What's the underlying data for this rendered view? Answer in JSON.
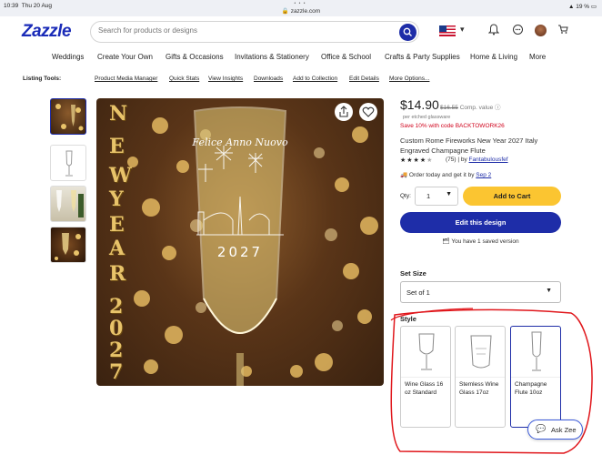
{
  "statusbar": {
    "time": "10:39",
    "date": "Thu 20 Aug",
    "url": "zazzle.com",
    "battery": "19 %"
  },
  "header": {
    "logo": "Zazzle",
    "search_placeholder": "Search for products or designs"
  },
  "nav": [
    "Weddings",
    "Create Your Own",
    "Gifts & Occasions",
    "Invitations & Stationery",
    "Office & School",
    "Crafts & Party Supplies",
    "Home & Living",
    "More"
  ],
  "listing_tools": {
    "label": "Listing Tools:",
    "links": [
      "Product Media Manager",
      "Quick Stats",
      "View Insights",
      "Downloads",
      "Add to Collection",
      "Edit Details",
      "More Options..."
    ]
  },
  "hero": {
    "ny_text": [
      "N",
      "E",
      "W",
      "Y",
      "E",
      "A",
      "R",
      "2",
      "0",
      "2",
      "7"
    ],
    "glass_text": "Felice Anno Nuovo",
    "glass_year": "2027"
  },
  "product": {
    "price": "$14.90",
    "old_price": "$16.55",
    "comp": "Comp. value",
    "per_unit": "per etched glassware",
    "promo": "Save 10% with code BACKTOWORK26",
    "title": "Custom Rome Fireworks New Year 2027 Italy Engraved Champagne Flute",
    "rating_stars": 4.5,
    "rating_count": "(75)",
    "by": "| by",
    "seller": "Fantabulousfef",
    "delivery_text": "Order today and get it by",
    "delivery_date": "Sep 2",
    "qty_label": "Qty:",
    "qty_value": "1",
    "add_to_cart": "Add to Cart",
    "edit_design": "Edit this design",
    "saved_version": "You have 1 saved version"
  },
  "set_size": {
    "label": "Set Size",
    "value": "Set of 1"
  },
  "style": {
    "label": "Style",
    "options": [
      {
        "label": "Wine Glass 16 oz Standard",
        "selected": false
      },
      {
        "label": "Stemless Wine Glass 17oz",
        "selected": false
      },
      {
        "label": "Champagne Flute 10oz",
        "selected": true
      }
    ]
  },
  "ask_zee": "Ask Zee",
  "colors": {
    "brand_blue": "#1e2da8",
    "cart_yellow": "#fbc531",
    "promo_red": "#d0021b",
    "annotation_red": "#e0161b"
  }
}
